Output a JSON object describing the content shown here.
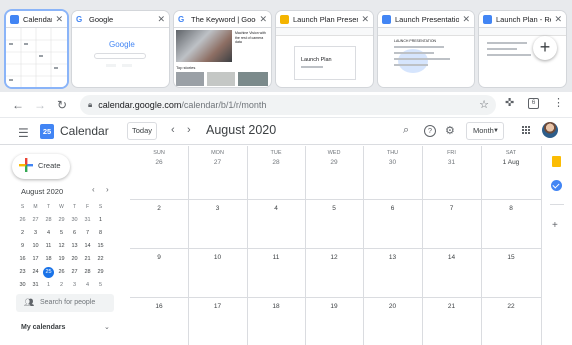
{
  "tabs": [
    {
      "title": "Calendar - Au...",
      "active": true
    },
    {
      "title": "Google"
    },
    {
      "title": "The Keyword | Google"
    },
    {
      "title": "Launch Plan Presentat..."
    },
    {
      "title": "Launch Presentation ..."
    },
    {
      "title": "Launch Plan - Resear..."
    }
  ],
  "tab_thumbs": {
    "google_logo": "Google",
    "keyword_headline": "Machine Vision with the rest of camera data",
    "keyword_caption": "Top stories",
    "slides_title": "Launch Plan",
    "doc_heading": "LAUNCH PRESENTATION"
  },
  "new_tab_label": "+",
  "toolbar": {
    "url_host": "calendar.google.com",
    "url_path": "/calendar/b/1/r/month",
    "tab_count": "6"
  },
  "calendar": {
    "app_name": "Calendar",
    "logo_day": "25",
    "today_label": "Today",
    "month_title": "August 2020",
    "view_label": "Month",
    "create_label": "Create",
    "search_people_placeholder": "Search for people",
    "my_calendars_label": "My calendars"
  },
  "mini_calendar": {
    "title": "August 2020",
    "dow": [
      "S",
      "M",
      "T",
      "W",
      "T",
      "F",
      "S"
    ],
    "weeks": [
      [
        "26",
        "27",
        "28",
        "29",
        "30",
        "31",
        "1"
      ],
      [
        "2",
        "3",
        "4",
        "5",
        "6",
        "7",
        "8"
      ],
      [
        "9",
        "10",
        "11",
        "12",
        "13",
        "14",
        "15"
      ],
      [
        "16",
        "17",
        "18",
        "19",
        "20",
        "21",
        "22"
      ],
      [
        "23",
        "24",
        "25",
        "26",
        "27",
        "28",
        "29"
      ],
      [
        "30",
        "31",
        "1",
        "2",
        "3",
        "4",
        "5"
      ]
    ],
    "today": "25"
  },
  "month_grid": {
    "dow": [
      "SUN",
      "MON",
      "TUE",
      "WED",
      "THU",
      "FRI",
      "SAT"
    ],
    "weeks": [
      [
        "26",
        "27",
        "28",
        "29",
        "30",
        "31",
        "1 Aug"
      ],
      [
        "2",
        "3",
        "4",
        "5",
        "6",
        "7",
        "8"
      ],
      [
        "9",
        "10",
        "11",
        "12",
        "13",
        "14",
        "15"
      ],
      [
        "16",
        "17",
        "18",
        "19",
        "20",
        "21",
        "22"
      ]
    ]
  },
  "colors": {
    "accent": "#1a73e8",
    "keep": "#fbbc04",
    "tasks": "#4285f4"
  },
  "icons": [
    "back-arrow-icon",
    "forward-arrow-icon",
    "reload-icon",
    "lock-icon",
    "star-icon",
    "extensions-icon",
    "menu-dots-icon",
    "hamburger-icon",
    "search-icon",
    "help-icon",
    "settings-icon",
    "apps-grid-icon",
    "people-icon",
    "keep-icon",
    "tasks-icon",
    "add-addon-icon"
  ]
}
